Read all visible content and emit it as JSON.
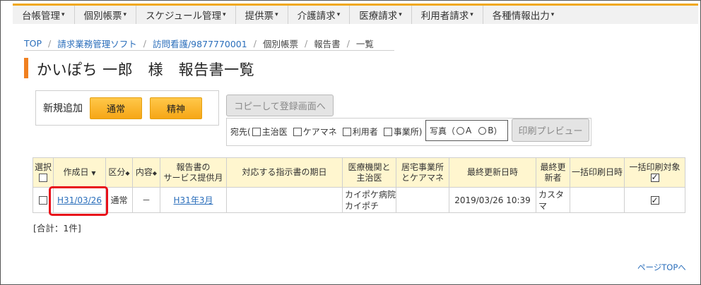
{
  "nav": [
    {
      "label": "台帳管理",
      "caret": "▾"
    },
    {
      "label": "個別帳票",
      "caret": "▾"
    },
    {
      "label": "スケジュール管理",
      "caret": "▾"
    },
    {
      "label": "提供票",
      "caret": "▾"
    },
    {
      "label": "介護請求",
      "caret": "▾"
    },
    {
      "label": "医療請求",
      "caret": "▾"
    },
    {
      "label": "利用者請求",
      "caret": "▾"
    },
    {
      "label": "各種情報出力",
      "caret": "▾"
    }
  ],
  "breadcrumb": [
    "TOP",
    "請求業務管理ソフト",
    "訪問看護/9877770001",
    "個別帳票",
    "報告書",
    "一覧"
  ],
  "breadcrumb_sep": "/",
  "page_title": "かいぽち 一郎　様　報告書一覧",
  "add": {
    "label": "新規追加",
    "normal_btn": "通常",
    "seishin_btn": "精神"
  },
  "copy_btn": "コピーして登録画面へ",
  "destination": {
    "prefix": "宛先(",
    "suffix": ")",
    "options": [
      "主治医",
      "ケアマネ",
      "利用者",
      "事業所"
    ]
  },
  "photo": {
    "label": "写真（",
    "opt_a": "A",
    "opt_b": "B",
    "suffix": "）"
  },
  "print_preview_btn": "印刷プレビュー",
  "table": {
    "headers": {
      "select": "選択",
      "created": "作成日",
      "kubun": "区分",
      "naiyo": "内容",
      "service_month_1": "報告書の",
      "service_month_2": "サービス提供月",
      "instruction": "対応する指示書の期日",
      "medical_1": "医療機関と",
      "medical_2": "主治医",
      "care_1": "居宅事業所",
      "care_2": "とケアマネ",
      "updated": "最終更新日時",
      "updater_1": "最終更",
      "updater_2": "新者",
      "bulk_date": "一括印刷日時",
      "bulk_target": "一括印刷対象"
    },
    "sort_down": "▼",
    "sort_both": "◆",
    "rows": [
      {
        "created": "H31/03/26",
        "kubun": "通常",
        "naiyo": "－",
        "service_month": "H31年3月",
        "instruction": "",
        "medical_1": "カイポケ病院",
        "medical_2": "カイポチ",
        "care": "",
        "updated": "2019/03/26 10:39",
        "updater": "カスタマ",
        "bulk_date": ""
      }
    ]
  },
  "total": "[合計：1件]",
  "page_top": "ページTOPへ",
  "colors": {
    "accent": "#f0a818",
    "title_bar": "#f08020",
    "highlight": "#e8101a",
    "link": "#2a6ebb",
    "header_bg": "#fff6cf"
  }
}
